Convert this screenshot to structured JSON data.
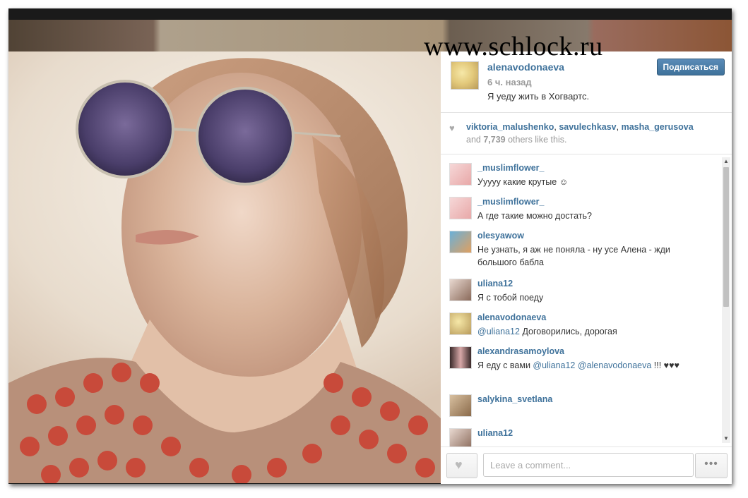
{
  "watermark": "www.schlock.ru",
  "post": {
    "username": "alenavodonaeva",
    "time": "6 ч. назад",
    "caption": "Я уеду жить в Хогвартс.",
    "follow_label": "Подписаться"
  },
  "likes": {
    "names": [
      "viktoria_malushenko",
      "savulechkasv",
      "masha_gerusova"
    ],
    "separator": ", ",
    "others_prefix": "and ",
    "others_count": "7,739",
    "others_suffix": " others like this."
  },
  "comments": [
    {
      "user": "_muslimflower_",
      "text": "Ууууу какие крутые ☺"
    },
    {
      "user": "_muslimflower_",
      "text": "А где такие можно достать?"
    },
    {
      "user": "olesyawow",
      "text": "Не узнать, я аж не поняла - ну усе Алена - жди большого бабла"
    },
    {
      "user": "uliana12",
      "text": "Я с тобой поеду"
    },
    {
      "user": "alenavodonaeva",
      "mention": "@uliana12",
      "text": " Договорились, дорогая "
    },
    {
      "user": "alexandrasamoylova",
      "text_pre": "Я еду с вами ",
      "mention1": "@uliana12",
      "mention2": "@alenavodonaeva",
      "text_post": " !!! ♥♥♥"
    },
    {
      "user": "salykina_svetlana",
      "text": ""
    },
    {
      "user": "uliana12",
      "text": ""
    }
  ],
  "footer": {
    "comment_placeholder": "Leave a comment...",
    "more_label": "•••"
  },
  "colors": {
    "link": "#3f729b",
    "button": "#3f729b"
  }
}
